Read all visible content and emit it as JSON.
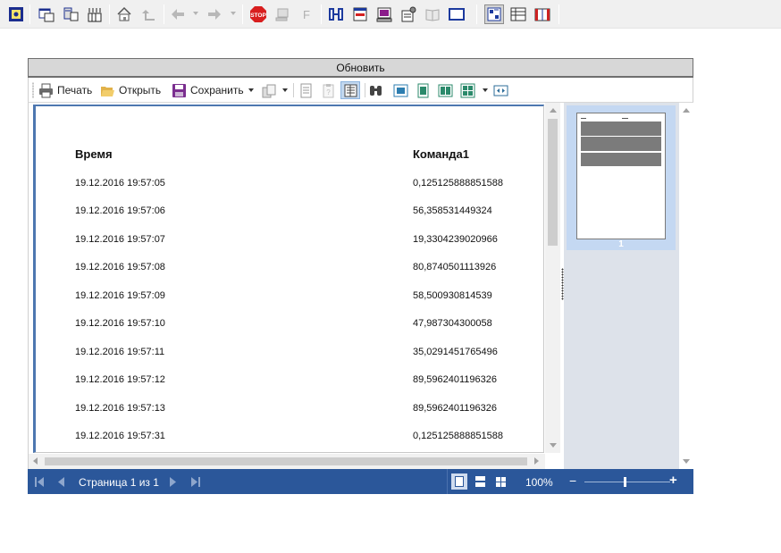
{
  "top_toolbar": {
    "icons": [
      "view-report-icon",
      "window-icon",
      "server-icon",
      "columns-icon",
      "home-icon",
      "up-level-icon",
      "back-icon",
      "forward-icon",
      "stop-icon",
      "computer-icon",
      "function-icon",
      "split-icon",
      "form-icon",
      "monitor-icon",
      "properties-icon",
      "book-icon",
      "window-frame-icon",
      "select-item-icon",
      "grid-list-icon",
      "report-book-icon"
    ],
    "stop_label": "STOP",
    "function_label": "F"
  },
  "viewer": {
    "refresh_label": "Обновить",
    "toolbar": {
      "print_label": "Печать",
      "open_label": "Открыть",
      "save_label": "Сохранить"
    },
    "report": {
      "columns": [
        "Время",
        "Команда1"
      ],
      "rows": [
        [
          "19.12.2016 19:57:05",
          "0,125125888851588"
        ],
        [
          "19.12.2016 19:57:06",
          "56,358531449324"
        ],
        [
          "19.12.2016 19:57:07",
          "19,3304239020966"
        ],
        [
          "19.12.2016 19:57:08",
          "80,8740501113926"
        ],
        [
          "19.12.2016 19:57:09",
          "58,500930814539"
        ],
        [
          "19.12.2016 19:57:10",
          "47,987304300058"
        ],
        [
          "19.12.2016 19:57:11",
          "35,0291451765496"
        ],
        [
          "19.12.2016 19:57:12",
          "89,5962401196326"
        ],
        [
          "19.12.2016 19:57:13",
          "89,5962401196326"
        ],
        [
          "19.12.2016 19:57:31",
          "0,125125888851588"
        ]
      ]
    },
    "thumbnail": {
      "page_number": "1"
    },
    "status": {
      "page_label": "Страница 1 из 1",
      "zoom_label": "100%",
      "zoom_minus": "−",
      "zoom_plus": "+",
      "zoom_level_percent": 100
    },
    "colors": {
      "status_bar": "#2b579a",
      "thumbnail_panel": "#dde2ea",
      "accent_border": "#4d77b0"
    }
  }
}
